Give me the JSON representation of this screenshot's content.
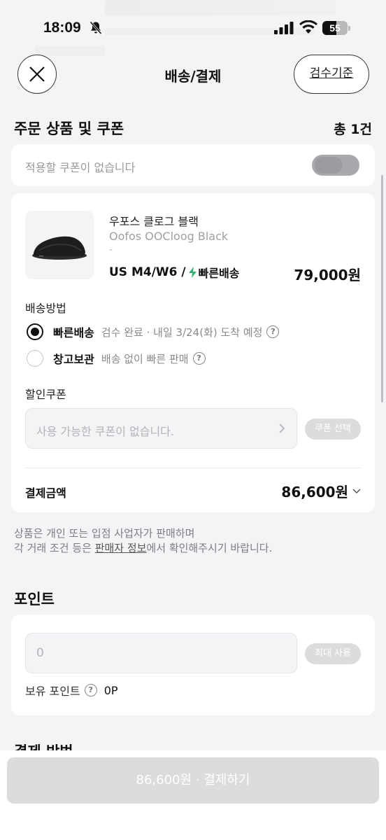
{
  "status_bar": {
    "time": "18:09",
    "battery": "55"
  },
  "header": {
    "title": "배송/결제",
    "criteria_button": "검수기준"
  },
  "order_section": {
    "title": "주문 상품 및 쿠폰",
    "count": "총 1건"
  },
  "coupon_toggle": {
    "text": "적용할 쿠폰이 없습니다",
    "enabled": false
  },
  "product": {
    "name_ko": "우포스 클로그 블랙",
    "name_en": "Oofos OOCloog Black",
    "sub": "-",
    "option": "US M4/W6 /",
    "fast_label": "빠른배송",
    "price": "79,000원"
  },
  "delivery": {
    "label": "배송방법",
    "options": [
      {
        "label": "빠른배송",
        "desc": "검수 완료 · 내일 3/24(화) 도착 예정",
        "selected": true
      },
      {
        "label": "창고보관",
        "desc": "배송 없이 빠른 판매",
        "selected": false
      }
    ]
  },
  "discount": {
    "label": "할인쿠폰",
    "placeholder": "사용 가능한 쿠폰이 없습니다.",
    "button": "쿠폰 선택"
  },
  "total": {
    "label": "결제금액",
    "value": "86,600원"
  },
  "notice": {
    "line1": "상품은 개인 또는 입점 사업자가 판매하며",
    "line2_pre": "각 거래 조건 등은 ",
    "line2_link": "판매자 정보",
    "line2_post": "에서 확인해주시기 바랍니다."
  },
  "points": {
    "title": "포인트",
    "input_value": "0",
    "max_button": "최대 사용",
    "own_label": "보유 포인트",
    "own_value": "0P"
  },
  "payment_section": {
    "title": "결제 방법"
  },
  "pay_button": {
    "label": "86,600원 · 결제하기"
  },
  "colors": {
    "accent_green": "#31b46e",
    "disabled": "#dcdcde"
  }
}
